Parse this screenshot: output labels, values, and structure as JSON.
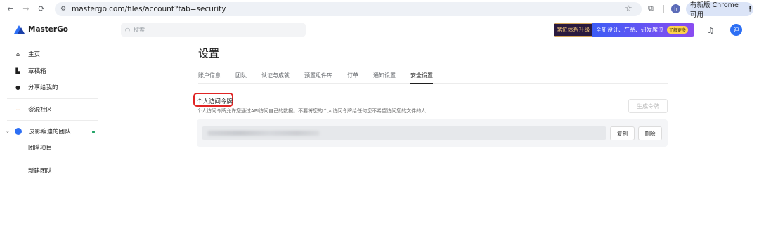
{
  "browser": {
    "url": "mastergo.com/files/account?tab=security",
    "profile_initial": "h",
    "update_label": "有新版 Chrome 可用",
    "menu_glyph": "⋮"
  },
  "header": {
    "brand": "MasterGo",
    "search_placeholder": "搜索",
    "banner": {
      "badge": "席位体系升级",
      "text": "全新设计、产品、研发席位",
      "cta": "了解更多"
    },
    "avatar_initial": "迪"
  },
  "sidebar": {
    "items": [
      {
        "label": "主页",
        "icon": "home-icon"
      },
      {
        "label": "草稿箱",
        "icon": "draft-icon"
      },
      {
        "label": "分享给我的",
        "icon": "user-icon"
      },
      {
        "label": "资源社区",
        "icon": "grid-icon"
      },
      {
        "label": "皮影蹁迪的团队",
        "icon": "team-dot"
      },
      {
        "label": "团队项目",
        "icon": ""
      },
      {
        "label": "新建团队",
        "icon": "plus-icon"
      }
    ]
  },
  "main": {
    "title": "设置",
    "tabs": [
      {
        "label": "账户信息",
        "active": false
      },
      {
        "label": "团队",
        "active": false
      },
      {
        "label": "认证与成就",
        "active": false
      },
      {
        "label": "预置组件库",
        "active": false
      },
      {
        "label": "订单",
        "active": false
      },
      {
        "label": "通知设置",
        "active": false
      },
      {
        "label": "安全设置",
        "active": true
      }
    ],
    "section": {
      "title": "个人访问令牌",
      "description": "个人访问令牌允许您通过API访问自己的数据。不要将您的个人访问令牌给任何您不希望访问您的文件的人",
      "generate_label": "生成令牌",
      "copy_label": "复制",
      "delete_label": "删除"
    }
  },
  "colors": {
    "accent": "#2d6ff4",
    "highlight": "#e02424"
  }
}
